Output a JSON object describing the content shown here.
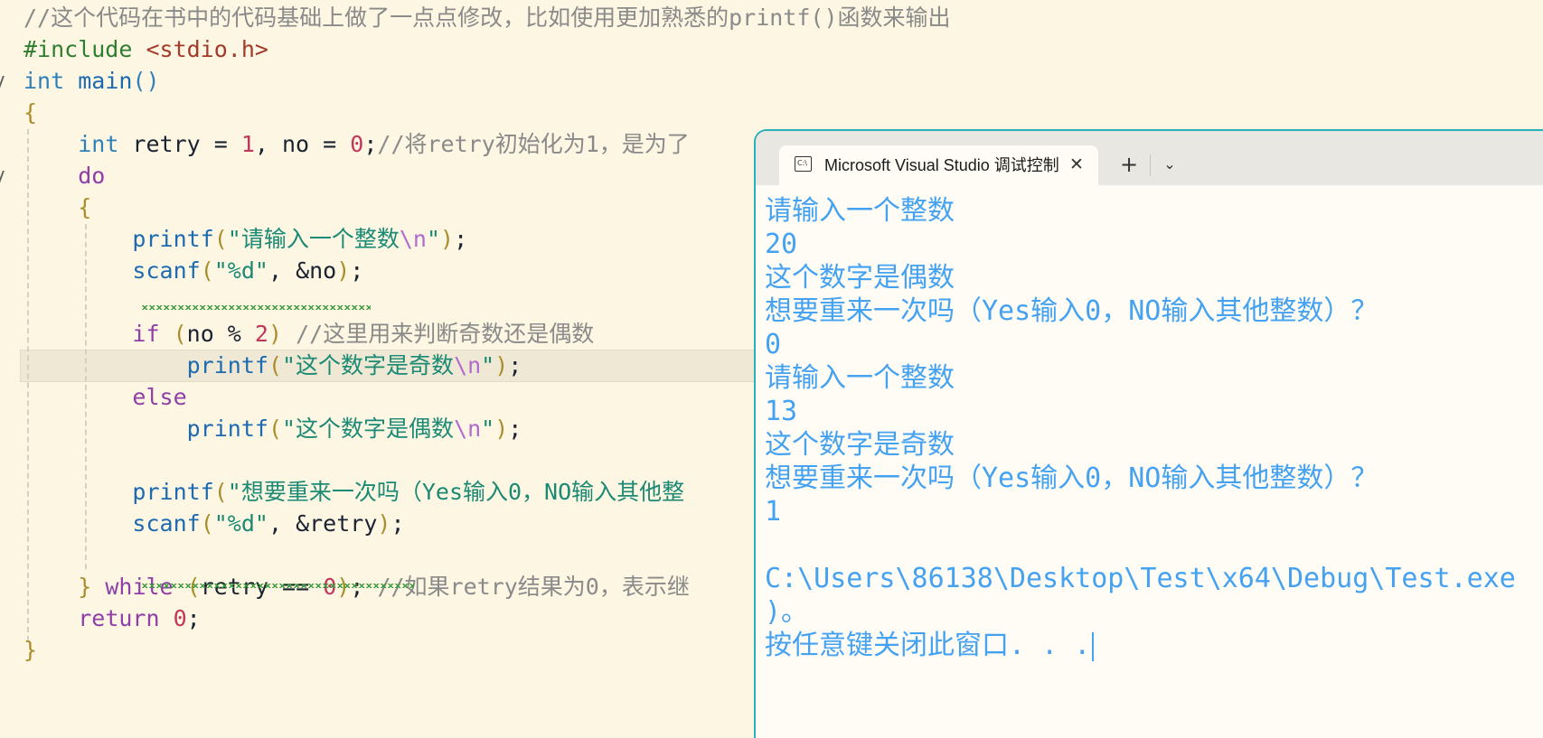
{
  "editor": {
    "lines": [
      {
        "segments": [
          {
            "c": "t-comment",
            "t": "//这个代码在书中的代码基础上做了一点点修改，比如使用更加熟悉的printf()函数来输出"
          }
        ]
      },
      {
        "segments": [
          {
            "c": "t-pp",
            "t": "#include "
          },
          {
            "c": "t-inc",
            "t": "<stdio.h>"
          }
        ]
      },
      {
        "segments": [
          {
            "c": "t-kw",
            "t": "int"
          },
          {
            "c": "t-op",
            "t": " "
          },
          {
            "c": "t-fn",
            "t": "main"
          },
          {
            "c": "t-br3",
            "t": "()"
          }
        ]
      },
      {
        "segments": [
          {
            "c": "t-br1",
            "t": "{"
          }
        ]
      },
      {
        "segments": [
          {
            "c": "t-op",
            "t": "    "
          },
          {
            "c": "t-kw",
            "t": "int"
          },
          {
            "c": "t-var",
            "t": " retry = "
          },
          {
            "c": "t-num",
            "t": "1"
          },
          {
            "c": "t-var",
            "t": ", no = "
          },
          {
            "c": "t-num",
            "t": "0"
          },
          {
            "c": "t-var",
            "t": ";"
          },
          {
            "c": "t-comment",
            "t": "//将retry初始化为1，是为了"
          }
        ]
      },
      {
        "segments": [
          {
            "c": "t-op",
            "t": "    "
          },
          {
            "c": "t-ctrl",
            "t": "do"
          }
        ]
      },
      {
        "segments": [
          {
            "c": "t-op",
            "t": "    "
          },
          {
            "c": "t-br1",
            "t": "{"
          }
        ]
      },
      {
        "segments": [
          {
            "c": "t-op",
            "t": "        "
          },
          {
            "c": "t-fn",
            "t": "printf"
          },
          {
            "c": "t-br1",
            "t": "("
          },
          {
            "c": "t-str",
            "t": "\"请输入一个整数"
          },
          {
            "c": "t-esc",
            "t": "\\n"
          },
          {
            "c": "t-str",
            "t": "\""
          },
          {
            "c": "t-br1",
            "t": ")"
          },
          {
            "c": "t-var",
            "t": ";"
          }
        ]
      },
      {
        "segments": [
          {
            "c": "t-op",
            "t": "        "
          },
          {
            "c": "t-fn",
            "t": "scanf"
          },
          {
            "c": "t-br1",
            "t": "("
          },
          {
            "c": "t-str",
            "t": "\"%d\""
          },
          {
            "c": "t-var",
            "t": ", &no"
          },
          {
            "c": "t-br1",
            "t": ")"
          },
          {
            "c": "t-var",
            "t": ";"
          }
        ]
      },
      {
        "segments": [
          {
            "c": "t-op",
            "t": ""
          }
        ]
      },
      {
        "segments": [
          {
            "c": "t-op",
            "t": "        "
          },
          {
            "c": "t-ctrl",
            "t": "if"
          },
          {
            "c": "t-var",
            "t": " "
          },
          {
            "c": "t-br1",
            "t": "("
          },
          {
            "c": "t-var",
            "t": "no % "
          },
          {
            "c": "t-num",
            "t": "2"
          },
          {
            "c": "t-br1",
            "t": ")"
          },
          {
            "c": "t-var",
            "t": " "
          },
          {
            "c": "t-comment",
            "t": "//这里用来判断奇数还是偶数"
          }
        ]
      },
      {
        "segments": [
          {
            "c": "t-op",
            "t": "            "
          },
          {
            "c": "t-fn",
            "t": "printf"
          },
          {
            "c": "t-br1",
            "t": "("
          },
          {
            "c": "t-str",
            "t": "\"这个数字是奇数"
          },
          {
            "c": "t-esc",
            "t": "\\n"
          },
          {
            "c": "t-str",
            "t": "\""
          },
          {
            "c": "t-br1",
            "t": ")"
          },
          {
            "c": "t-var",
            "t": ";"
          }
        ]
      },
      {
        "segments": [
          {
            "c": "t-op",
            "t": "        "
          },
          {
            "c": "t-ctrl",
            "t": "else"
          }
        ]
      },
      {
        "segments": [
          {
            "c": "t-op",
            "t": "            "
          },
          {
            "c": "t-fn",
            "t": "printf"
          },
          {
            "c": "t-br1",
            "t": "("
          },
          {
            "c": "t-str",
            "t": "\"这个数字是偶数"
          },
          {
            "c": "t-esc",
            "t": "\\n"
          },
          {
            "c": "t-str",
            "t": "\""
          },
          {
            "c": "t-br1",
            "t": ")"
          },
          {
            "c": "t-var",
            "t": ";"
          }
        ]
      },
      {
        "segments": [
          {
            "c": "t-op",
            "t": ""
          }
        ]
      },
      {
        "segments": [
          {
            "c": "t-op",
            "t": "        "
          },
          {
            "c": "t-fn",
            "t": "printf"
          },
          {
            "c": "t-br1",
            "t": "("
          },
          {
            "c": "t-str",
            "t": "\"想要重来一次吗（Yes输入0，NO输入其他整"
          }
        ]
      },
      {
        "segments": [
          {
            "c": "t-op",
            "t": "        "
          },
          {
            "c": "t-fn",
            "t": "scanf"
          },
          {
            "c": "t-br1",
            "t": "("
          },
          {
            "c": "t-str",
            "t": "\"%d\""
          },
          {
            "c": "t-var",
            "t": ", &retry"
          },
          {
            "c": "t-br1",
            "t": ")"
          },
          {
            "c": "t-var",
            "t": ";"
          }
        ]
      },
      {
        "segments": [
          {
            "c": "t-op",
            "t": ""
          }
        ]
      },
      {
        "segments": [
          {
            "c": "t-op",
            "t": "    "
          },
          {
            "c": "t-br1",
            "t": "}"
          },
          {
            "c": "t-var",
            "t": " "
          },
          {
            "c": "t-ctrl",
            "t": "while"
          },
          {
            "c": "t-var",
            "t": " "
          },
          {
            "c": "t-br1",
            "t": "("
          },
          {
            "c": "t-var",
            "t": "retry == "
          },
          {
            "c": "t-num",
            "t": "0"
          },
          {
            "c": "t-br1",
            "t": ")"
          },
          {
            "c": "t-var",
            "t": "; "
          },
          {
            "c": "t-comment",
            "t": "//如果retry结果为0，表示继"
          }
        ]
      },
      {
        "segments": [
          {
            "c": "t-op",
            "t": "    "
          },
          {
            "c": "t-ctrl",
            "t": "return"
          },
          {
            "c": "t-var",
            "t": " "
          },
          {
            "c": "t-num",
            "t": "0"
          },
          {
            "c": "t-var",
            "t": ";"
          }
        ]
      },
      {
        "segments": [
          {
            "c": "t-br1",
            "t": "}"
          }
        ]
      }
    ]
  },
  "terminal": {
    "tab_title": "Microsoft Visual Studio 调试控制台",
    "icon_label": "C:\\",
    "close_glyph": "✕",
    "new_tab_glyph": "+",
    "dropdown_glyph": "⌄",
    "output_lines": [
      "请输入一个整数",
      "20",
      "这个数字是偶数",
      "想要重来一次吗（Yes输入0，NO输入其他整数）？",
      "0",
      "请输入一个整数",
      "13",
      "这个数字是奇数",
      "想要重来一次吗（Yes输入0，NO输入其他整数）？",
      "1",
      "",
      "C:\\Users\\86138\\Desktop\\Test\\x64\\Debug\\Test.exe",
      ")。",
      "按任意键关闭此窗口. . ."
    ]
  }
}
